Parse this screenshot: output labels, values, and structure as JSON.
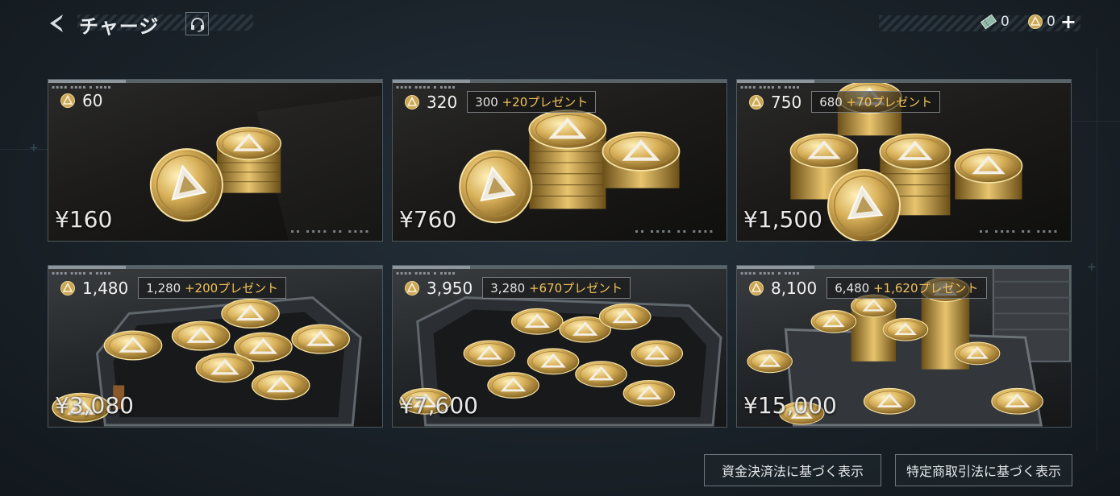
{
  "header": {
    "title": "チャージ",
    "back_icon": "chevron-left-icon",
    "support_icon": "headset-icon",
    "currencies": [
      {
        "icon": "ticket-icon",
        "value": "0"
      },
      {
        "icon": "coin-icon",
        "value": "0"
      }
    ],
    "plus_label": "+"
  },
  "colors": {
    "bonus_accent": "#f2c25a",
    "border": "#4d5860",
    "background": "#1a2229"
  },
  "packs": [
    {
      "coins": "60",
      "bonus_base": "",
      "bonus_extra": "",
      "price": "¥160",
      "art": "small-coin-stack"
    },
    {
      "coins": "320",
      "bonus_base": "300 ",
      "bonus_extra": "+20プレゼント",
      "price": "¥760",
      "art": "coin-stacks"
    },
    {
      "coins": "750",
      "bonus_base": "680 ",
      "bonus_extra": "+70プレゼント",
      "price": "¥1,500",
      "art": "coin-piles"
    },
    {
      "coins": "1,480",
      "bonus_base": "1,280 ",
      "bonus_extra": "+200プレゼント",
      "price": "¥3,080",
      "art": "coin-case-small"
    },
    {
      "coins": "3,950",
      "bonus_base": "3,280 ",
      "bonus_extra": "+670プレゼント",
      "price": "¥7,600",
      "art": "coin-case-medium"
    },
    {
      "coins": "8,100",
      "bonus_base": "6,480 ",
      "bonus_extra": "+1,620プレゼント",
      "price": "¥15,000",
      "art": "coin-crate-large"
    }
  ],
  "footer": {
    "payment_law_label": "資金決済法に基づく表示",
    "commerce_law_label": "特定商取引法に基づく表示"
  }
}
